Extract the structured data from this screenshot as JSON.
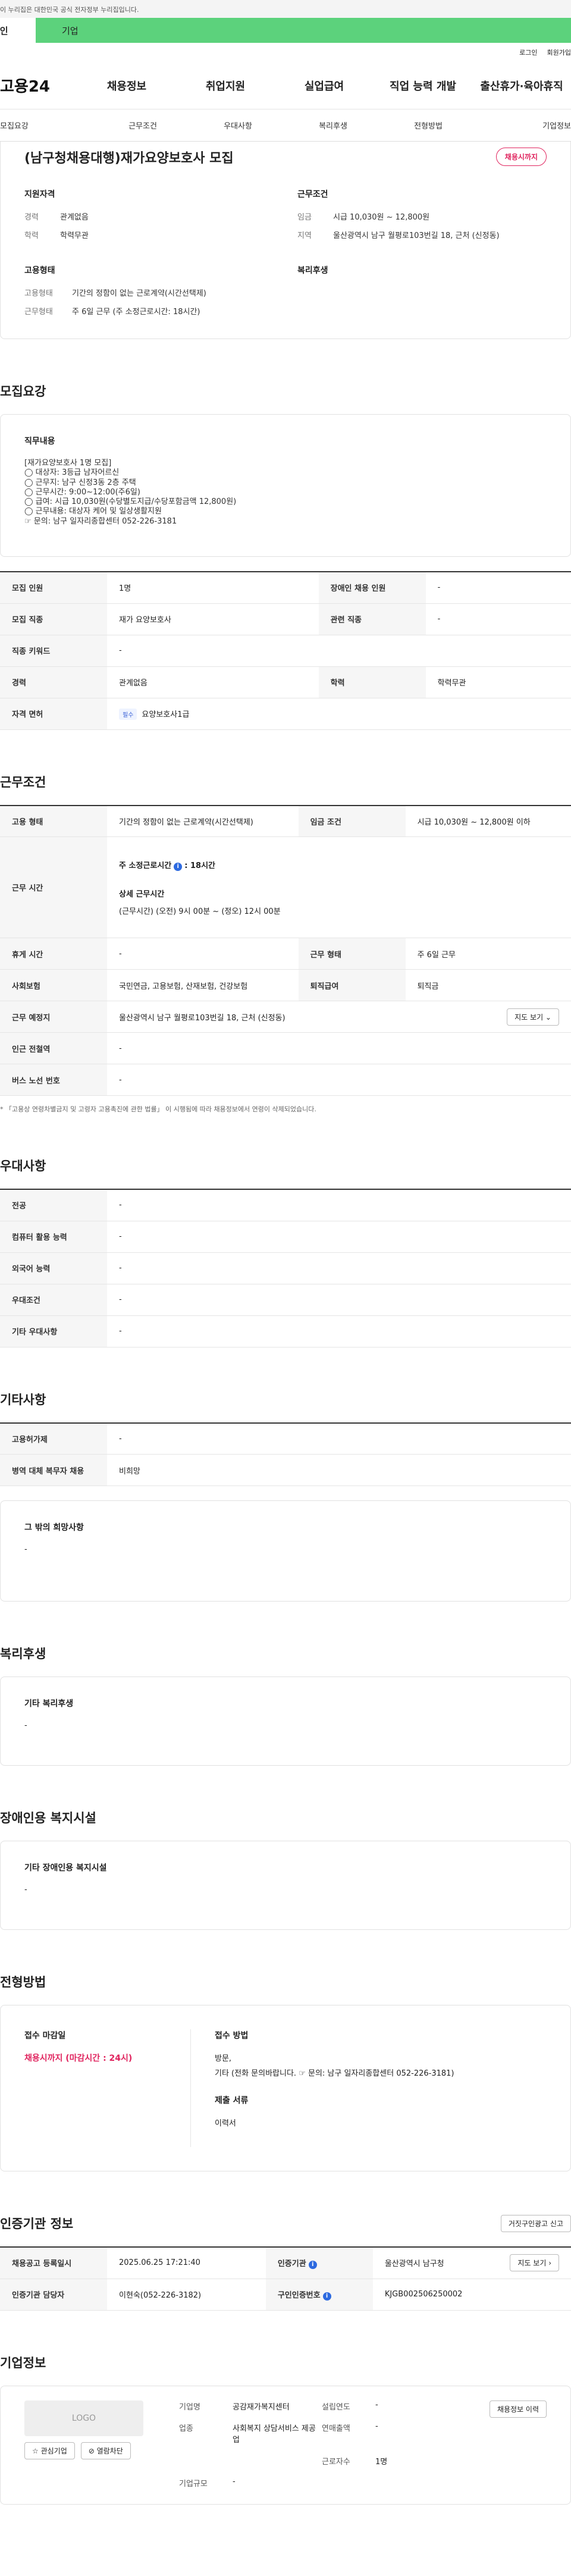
{
  "gov_bar": "이 누리집은 대한민국 공식 전자정부 누리집입니다.",
  "tabs": {
    "personal": "개인",
    "biz": "기업"
  },
  "util": {
    "login": "로그인",
    "signup": "회원가입"
  },
  "gnb": {
    "logo": "고용24",
    "items": [
      "채용정보",
      "취업지원",
      "실업급여",
      "직업 능력 개발",
      "출산휴가·육아휴직"
    ]
  },
  "subnav": [
    "모집요강",
    "근무조건",
    "우대사항",
    "복리후생",
    "전형방법",
    "기업정보"
  ],
  "summary": {
    "title": "(남구청채용대행)재가요양보호사 모집",
    "badge": "채용시까지",
    "qual_title": "지원자격",
    "qual": [
      {
        "k": "경력",
        "v": "관계없음"
      },
      {
        "k": "학력",
        "v": "학력무관"
      }
    ],
    "cond_title": "근무조건",
    "cond": [
      {
        "k": "임금",
        "v": "시급 10,030원 ~ 12,800원"
      },
      {
        "k": "지역",
        "v": "울산광역시 남구 월평로103번길 18, 근처 (신정동)"
      }
    ],
    "emp_title": "고용형태",
    "emp": [
      {
        "k": "고용형태",
        "v": "기간의 정함이 없는 근로계약(시간선택제)"
      },
      {
        "k": "근무형태",
        "v": "주 6일 근무 (주 소정근로시간: 18시간)"
      }
    ],
    "welfare_title": "복리후생"
  },
  "recruit": {
    "title": "모집요강",
    "job_h": "직무내용",
    "job_lines": [
      "[재가요양보호사 1명 모집]",
      "◯ 대상자: 3등급 남자어르신",
      "◯ 근무지: 남구 신정3동 2층 주택",
      "◯ 근무시간: 9:00~12:00(주6일)",
      "◯ 급여: 시급 10,030원(수당별도지급/수당포함금액 12,800원)",
      "◯ 근무내용: 대상자 케어 및 일상생활지원",
      "☞ 문의: 남구 일자리종합센터 052-226-3181"
    ],
    "table": {
      "r1": [
        "모집 인원",
        "1명",
        "장애인 채용 인원",
        "-"
      ],
      "r2": [
        "모집 직종",
        "재가 요양보호사",
        "관련 직종",
        "-"
      ],
      "r3": [
        "직종 키워드",
        "-"
      ],
      "r4": [
        "경력",
        "관계없음",
        "학력",
        "학력무관"
      ],
      "r5": [
        "자격 면허",
        "필수",
        "요양보호사1급"
      ]
    }
  },
  "work": {
    "title": "근무조건",
    "r1": [
      "고용 형태",
      "기간의 정함이 없는 근로계약(시간선택제)",
      "임금 조건",
      "시급 10,030원 ~ 12,800원 이하"
    ],
    "time_k": "근무 시간",
    "time_weekly": "주 소정근로시간",
    "time_weekly_v": ": 18시간",
    "time_detail_h": "상세 근무시간",
    "time_detail": "(근무시간) (오전) 9시 00분 ~ (정오) 12시 00분",
    "r3": [
      "휴게 시간",
      "-",
      "근무 형태",
      "주 6일 근무"
    ],
    "r4": [
      "사회보험",
      "국민연금, 고용보험, 산재보험, 건강보험",
      "퇴직급여",
      "퇴직금"
    ],
    "r5": [
      "근무 예정지",
      "울산광역시 남구 월평로103번길 18, 근처 (신정동)",
      "지도 보기 ⌄"
    ],
    "r6": [
      "인근 전철역",
      "-"
    ],
    "r7": [
      "버스 노선 번호",
      "-"
    ],
    "note": "* 「고용상 연령차별금지 및 고령자 고용촉진에 관한 법률」 이 시행됨에 따라 채용정보에서 연령이 삭제되었습니다."
  },
  "pref": {
    "title": "우대사항",
    "rows": [
      [
        "전공",
        "-"
      ],
      [
        "컴퓨터 활용 능력",
        "-"
      ],
      [
        "외국어 능력",
        "-"
      ],
      [
        "우대조건",
        "-"
      ],
      [
        "기타 우대사항",
        "-"
      ]
    ]
  },
  "etc": {
    "title": "기타사항",
    "rows": [
      [
        "고용허가제",
        "-"
      ],
      [
        "병역 대체 복무자 채용",
        "비희망"
      ]
    ],
    "hope_h": "그 밖의 희망사항",
    "hope_v": "-"
  },
  "welfare": {
    "title": "복리후생",
    "h": "기타 복리후생",
    "v": "-"
  },
  "disabled": {
    "title": "장애인용 복지시설",
    "h": "기타 장애인용 복지시설",
    "v": "-"
  },
  "method": {
    "title": "전형방법",
    "deadline_h": "접수 마감일",
    "deadline_v": "채용시까지 (마감시간 : 24시)",
    "way_h": "접수 방법",
    "way_lines": [
      "방문,",
      "기타 (전화 문의바랍니다. ☞ 문의: 남구 일자리종합센터 052-226-3181)"
    ],
    "docs_h": "제출 서류",
    "docs_v": "이력서"
  },
  "cert": {
    "title": "인증기관 정보",
    "report_btn": "거짓구인광고 신고",
    "r1": [
      "채용공고 등록일시",
      "2025.06.25 17:21:40",
      "인증기관",
      "울산광역시 남구청",
      "지도 보기 ›"
    ],
    "r2": [
      "인증기관 담당자",
      "이현숙(052-226-3182)",
      "구인인증번호",
      "KJGB002506250002"
    ]
  },
  "company": {
    "title": "기업정보",
    "logo": "LOGO",
    "fav": "☆ 관심기업",
    "block": "⊘ 열람차단",
    "fields": [
      [
        "기업명",
        "공감재가복지센터",
        "설립연도",
        "-"
      ],
      [
        "업종",
        "사회복지 상담서비스 제공업",
        "연매출액",
        "-"
      ],
      [
        "",
        "",
        "근로자수",
        "1명"
      ],
      [
        "기업규모",
        "-",
        "",
        ""
      ]
    ],
    "history_btn": "채용정보 이력"
  }
}
